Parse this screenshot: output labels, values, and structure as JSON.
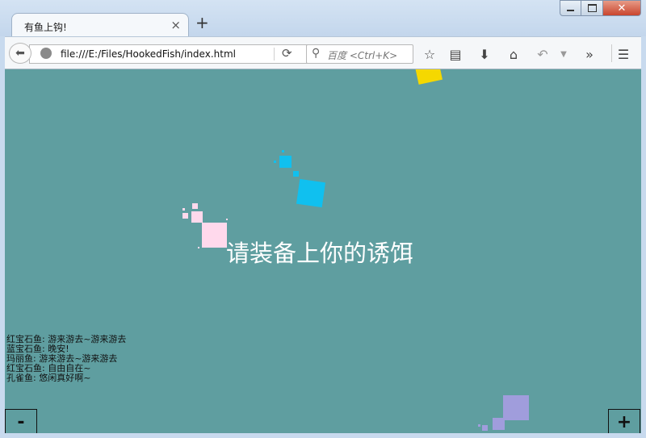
{
  "tab": {
    "title": "有鱼上钩!",
    "close": "×",
    "new_tab": "+"
  },
  "window": {
    "close": "✕"
  },
  "navbar": {
    "url": "file:///E:/Files/HookedFish/index.html",
    "search_placeholder": "百度 <Ctrl+K>"
  },
  "game": {
    "hint": "请装备上你的诱饵",
    "log": [
      "红宝石鱼: 游来游去~游来游去",
      "蓝宝石鱼: 晚安!",
      "玛丽鱼: 游来游去~游来游去",
      "红宝石鱼: 自由自在~",
      "孔雀鱼: 悠闲真好啊~"
    ],
    "zoom_out": "-",
    "zoom_in": "+",
    "colors": {
      "water": "#5f9ea0",
      "pink_fish": "#ffd9ec",
      "blue_fish": "#10c0ef",
      "yellow_fish": "#f5d800",
      "purple_fish": "#a09ddc"
    }
  }
}
